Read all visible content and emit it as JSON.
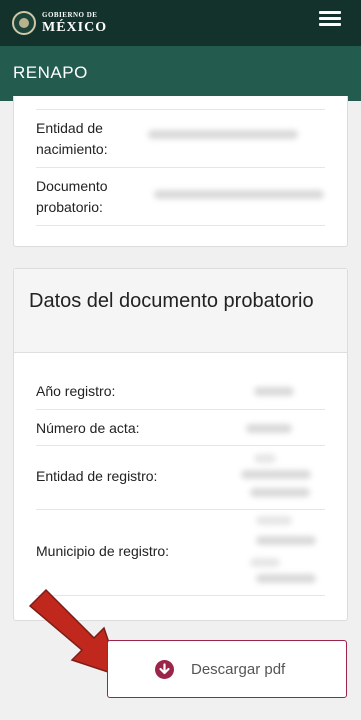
{
  "header": {
    "logo_top": "GOBIERNO DE",
    "logo_main": "MÉXICO",
    "menu_icon": "hamburger-menu-icon"
  },
  "subheader": {
    "title": "RENAPO"
  },
  "personal_panel": {
    "rows": [
      {
        "label": "Entidad de nacimiento:"
      },
      {
        "label": "Documento probatorio:"
      }
    ]
  },
  "document_panel": {
    "title": "Datos del documento probatorio",
    "rows": [
      {
        "label": "Año registro:"
      },
      {
        "label": "Número de acta:"
      },
      {
        "label": "Entidad de registro:"
      },
      {
        "label": "Municipio de registro:"
      }
    ]
  },
  "download": {
    "label": "Descargar pdf",
    "icon": "arrow-down-circle-icon"
  },
  "annotation": {
    "icon": "red-pointer-arrow-icon"
  },
  "colors": {
    "header_dark": "#13322b",
    "header_green": "#235b4e",
    "accent": "#9d2449",
    "annotation_red": "#c0281d"
  }
}
